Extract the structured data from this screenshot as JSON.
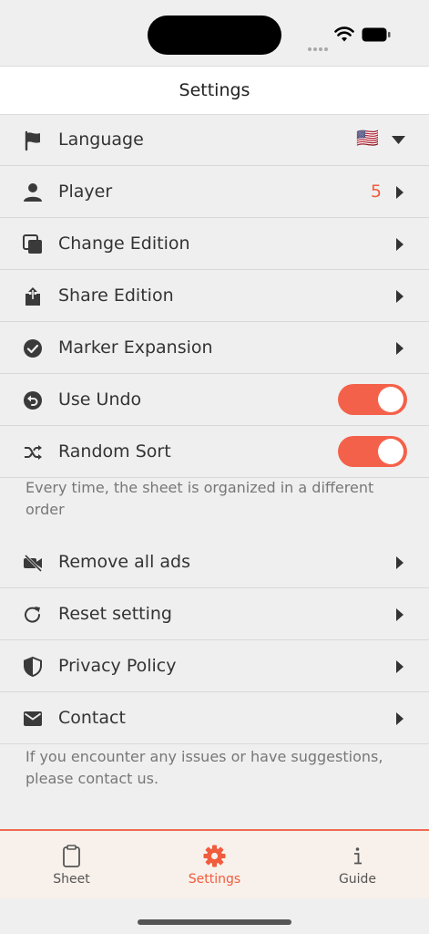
{
  "header": {
    "title": "Settings"
  },
  "settings_group1": [
    {
      "label": "Language",
      "icon": "flag-icon",
      "accessory": "flag-dropdown",
      "flag": "🇺🇸"
    },
    {
      "label": "Player",
      "icon": "person-icon",
      "accessory": "value-chevron",
      "value": "5"
    },
    {
      "label": "Change Edition",
      "icon": "copy-icon",
      "accessory": "chevron"
    },
    {
      "label": "Share Edition",
      "icon": "share-icon",
      "accessory": "chevron"
    },
    {
      "label": "Marker Expansion",
      "icon": "check-circle-icon",
      "accessory": "chevron"
    },
    {
      "label": "Use Undo",
      "icon": "undo-icon",
      "accessory": "toggle",
      "on": true
    },
    {
      "label": "Random Sort",
      "icon": "shuffle-icon",
      "accessory": "toggle",
      "on": true
    }
  ],
  "random_sort_note": "Every time, the sheet is organized in a different order",
  "settings_group2": [
    {
      "label": "Remove all ads",
      "icon": "no-video-icon",
      "accessory": "chevron"
    },
    {
      "label": "Reset setting",
      "icon": "reset-icon",
      "accessory": "chevron"
    },
    {
      "label": "Privacy Policy",
      "icon": "shield-icon",
      "accessory": "chevron"
    },
    {
      "label": "Contact",
      "icon": "mail-icon",
      "accessory": "chevron"
    }
  ],
  "contact_note": "If you encounter any issues or have suggestions, please contact us.",
  "tabs": [
    {
      "label": "Sheet",
      "icon": "clipboard-icon",
      "active": false
    },
    {
      "label": "Settings",
      "icon": "gear-icon",
      "active": true
    },
    {
      "label": "Guide",
      "icon": "info-icon",
      "active": false
    }
  ],
  "colors": {
    "accent": "#f05c3e",
    "toggle_on": "#f4614a",
    "background": "#efefef"
  }
}
